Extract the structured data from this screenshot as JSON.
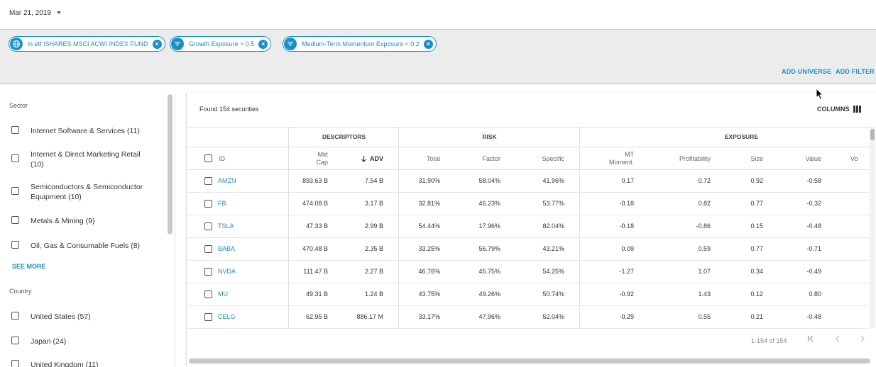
{
  "date_picker": {
    "value": "Mar 21, 2019"
  },
  "filters": [
    {
      "label": "in etf ISHARES MSCI ACWI INDEX FUND",
      "icon": "globe-icon"
    },
    {
      "label": "Growth Exposure > 0.5",
      "icon": "filter-icon"
    },
    {
      "label": "Medium-Term Momentum Exposure < 0.2",
      "icon": "filter-icon"
    }
  ],
  "actions": {
    "add_universe": "ADD UNIVERSE",
    "add_filter": "ADD FILTER"
  },
  "sidebar": {
    "sector_title": "Sector",
    "sector_items": [
      "Internet Software & Services (11)",
      "Internet & Direct Marketing Retail (10)",
      "Semiconductors & Semiconductor Equipment (10)",
      "Metals & Mining (9)",
      "Oil, Gas & Consumable Fuels (8)"
    ],
    "see_more": "SEE MORE",
    "country_title": "Country",
    "country_items": [
      "United States (57)",
      "Japan (24)",
      "United Kingdom (11)"
    ]
  },
  "results": {
    "found_text": "Found 154 securities",
    "columns_label": "COLUMNS",
    "groups": {
      "descriptors": "DESCRIPTORS",
      "risk": "RISK",
      "exposure": "EXPOSURE"
    },
    "headers": {
      "id": "ID",
      "mkt_cap_1": "Mkt",
      "mkt_cap_2": "Cap",
      "adv": "ADV",
      "total": "Total",
      "factor": "Factor",
      "specific": "Specific",
      "mt_1": "MT",
      "mt_2": "Moment.",
      "profitability": "Profitability",
      "size": "Size",
      "value": "Value",
      "vol": "Vo"
    },
    "rows": [
      {
        "id": "AMZN",
        "mkt_cap": "893.63 B",
        "adv": "7.54 B",
        "total": "31.90%",
        "factor": "58.04%",
        "specific": "41.96%",
        "mt": "0.17",
        "profitability": "0.72",
        "size": "0.92",
        "value": "-0.58"
      },
      {
        "id": "FB",
        "mkt_cap": "474.08 B",
        "adv": "3.17 B",
        "total": "32.81%",
        "factor": "46.23%",
        "specific": "53.77%",
        "mt": "-0.18",
        "profitability": "0.82",
        "size": "0.77",
        "value": "-0.32"
      },
      {
        "id": "TSLA",
        "mkt_cap": "47.33 B",
        "adv": "2.99 B",
        "total": "54.44%",
        "factor": "17.96%",
        "specific": "82.04%",
        "mt": "-0.18",
        "profitability": "-0.86",
        "size": "0.15",
        "value": "-0.48"
      },
      {
        "id": "BABA",
        "mkt_cap": "470.48 B",
        "adv": "2.35 B",
        "total": "33.25%",
        "factor": "56.79%",
        "specific": "43.21%",
        "mt": "0.09",
        "profitability": "0.59",
        "size": "0.77",
        "value": "-0.71"
      },
      {
        "id": "NVDA",
        "mkt_cap": "111.47 B",
        "adv": "2.27 B",
        "total": "46.76%",
        "factor": "45.75%",
        "specific": "54.25%",
        "mt": "-1.27",
        "profitability": "1.07",
        "size": "0.34",
        "value": "-0.49"
      },
      {
        "id": "MU",
        "mkt_cap": "49.31 B",
        "adv": "1.24 B",
        "total": "43.75%",
        "factor": "49.26%",
        "specific": "50.74%",
        "mt": "-0.92",
        "profitability": "1.43",
        "size": "0.12",
        "value": "0.80"
      },
      {
        "id": "CELG",
        "mkt_cap": "62.95 B",
        "adv": "886.17 M",
        "total": "33.17%",
        "factor": "47.96%",
        "specific": "52.04%",
        "mt": "-0.29",
        "profitability": "0.55",
        "size": "0.21",
        "value": "-0.48"
      }
    ],
    "pagination": {
      "range_text": "1-154 of 154"
    }
  }
}
